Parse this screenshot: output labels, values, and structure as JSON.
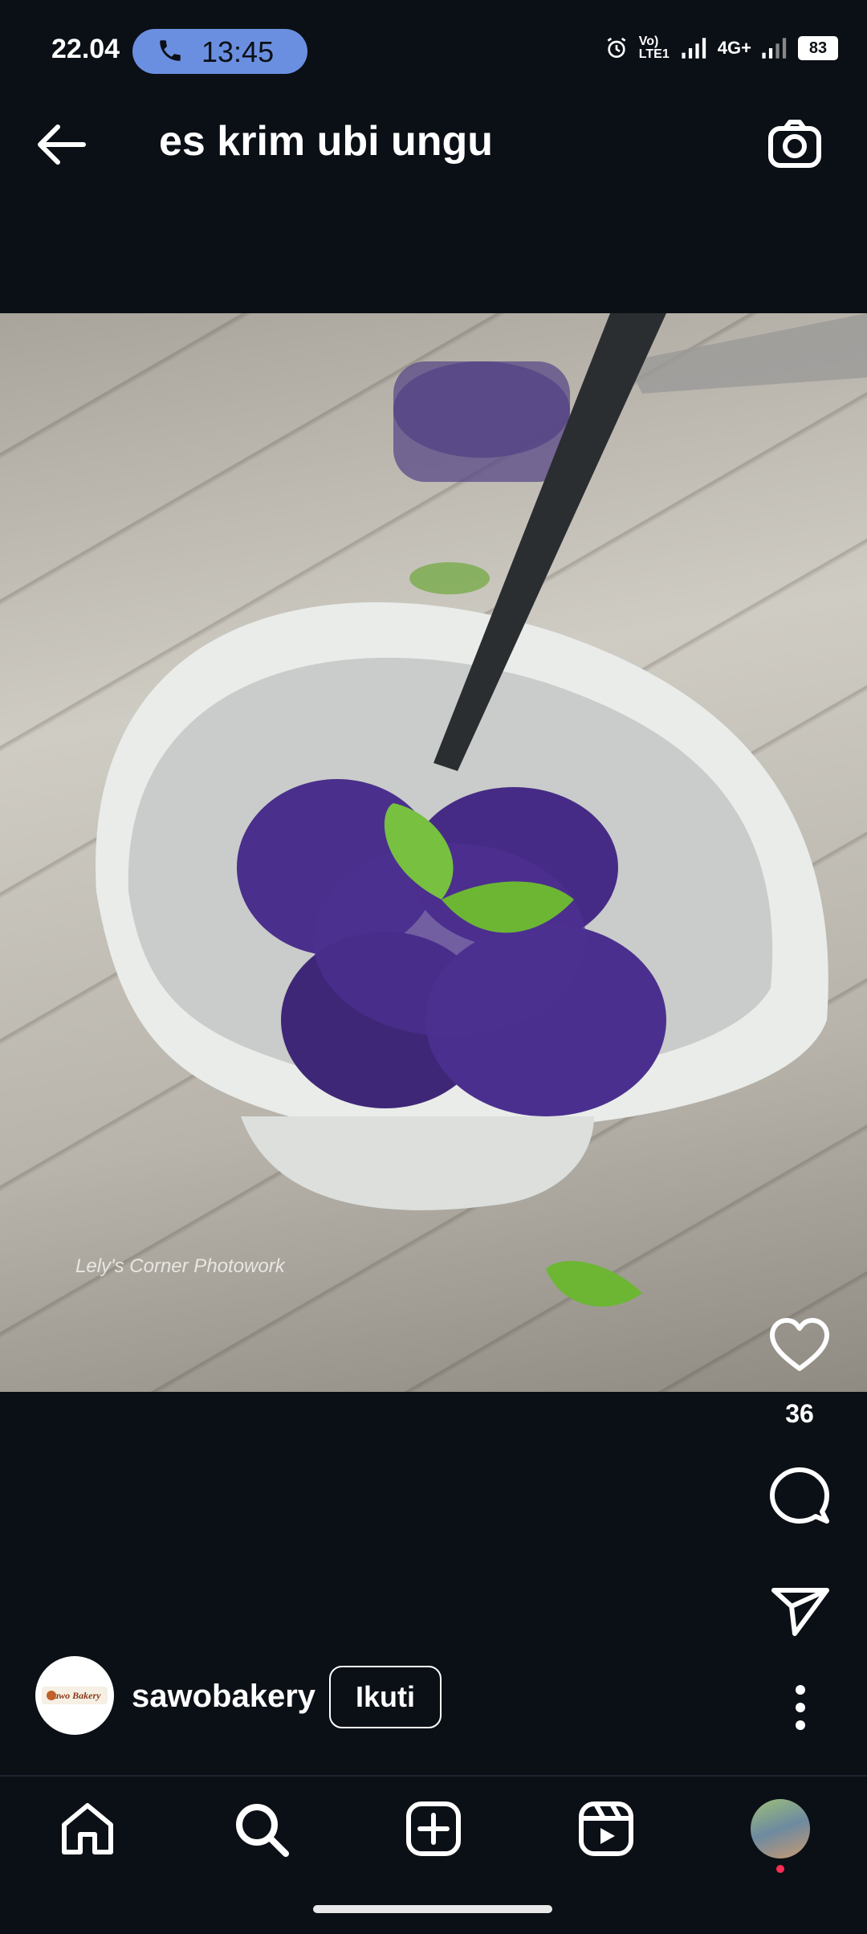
{
  "status_bar": {
    "clock": "22.04",
    "call_time": "13:45",
    "network_label": "4G+",
    "volte_label": "Vo) LTE1",
    "battery": "83"
  },
  "header": {
    "title": "es krim ubi ungu"
  },
  "post": {
    "image_alt": "purple sweet potato ice cream in a white bowl with mint leaf",
    "watermark": "Lely's Corner Photowork",
    "like_count": "36",
    "author": "sawobakery",
    "author_avatar_text": "Sawo Bakery",
    "follow_label": "Ikuti"
  },
  "icons": {
    "back": "arrow-left-icon",
    "camera": "camera-icon",
    "like": "heart-icon",
    "comment": "comment-bubble-icon",
    "share": "paper-plane-icon",
    "more": "more-vertical-icon",
    "home": "home-icon",
    "search": "search-icon",
    "create": "plus-square-icon",
    "reels": "reels-icon"
  },
  "colors": {
    "background": "#0b1016",
    "call_pill": "#6b8fe0",
    "ice_cream": "#4a2f8c",
    "notification_dot": "#ff2d55"
  }
}
